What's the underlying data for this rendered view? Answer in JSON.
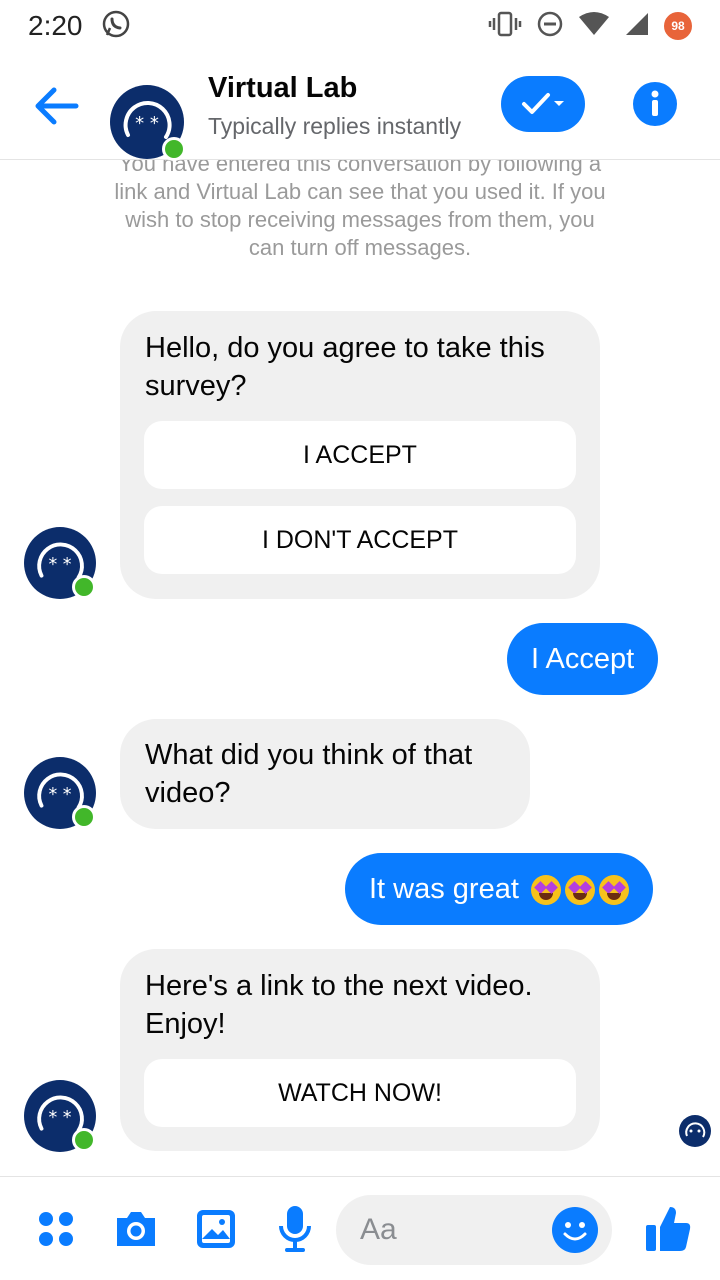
{
  "status_bar": {
    "time": "2:20",
    "battery": "98",
    "icons": [
      "whatsapp-icon",
      "vibrate-icon",
      "dnd-icon",
      "wifi-icon",
      "signal-icon",
      "battery-icon"
    ]
  },
  "header": {
    "title": "Virtual Lab",
    "subtitle": "Typically replies instantly",
    "accent_color": "#0a7cff"
  },
  "conversation": {
    "notice": "You have entered this conversation by following a link and Virtual Lab can see that you used it. If you wish to stop receiving messages from them, you can turn off messages.",
    "messages": [
      {
        "from": "bot",
        "text": "Hello, do you agree to take this survey?",
        "buttons": [
          "I ACCEPT",
          "I DON'T ACCEPT"
        ]
      },
      {
        "from": "user",
        "text": "I Accept"
      },
      {
        "from": "bot",
        "text": "What did you think of that video?"
      },
      {
        "from": "user",
        "text": "It was great",
        "emoji_count": 3
      },
      {
        "from": "bot",
        "text": "Here's a link to the next video. Enjoy!",
        "buttons": [
          "WATCH NOW!"
        ]
      }
    ]
  },
  "composer": {
    "placeholder": "Aa",
    "icons": [
      "apps-icon",
      "camera-icon",
      "gallery-icon",
      "microphone-icon",
      "emoji-icon",
      "thumbs-up-icon"
    ]
  }
}
